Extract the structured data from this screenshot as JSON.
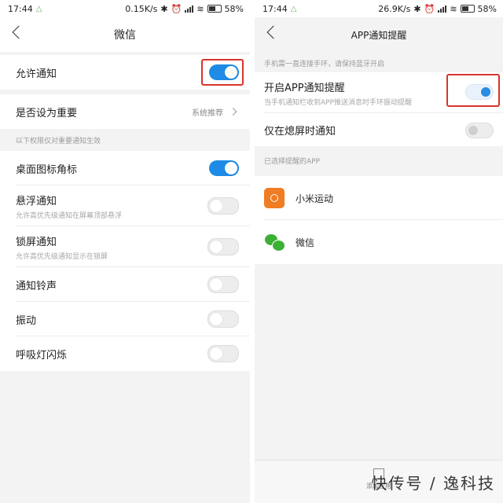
{
  "left": {
    "status": {
      "time": "17:44",
      "speed": "0.15K/s",
      "battery": "58%"
    },
    "title": "微信",
    "allow": {
      "label": "允许通知"
    },
    "important": {
      "label": "是否设为重要",
      "value": "系统推荐"
    },
    "section": "以下权限仅对重要通知生效",
    "items": [
      {
        "label": "桌面图标角标",
        "sub": "",
        "on": true
      },
      {
        "label": "悬浮通知",
        "sub": "允许高优先级通知在屏幕顶部悬浮",
        "on": false
      },
      {
        "label": "锁屏通知",
        "sub": "允许高优先级通知显示在锁屏",
        "on": false
      },
      {
        "label": "通知铃声",
        "sub": "",
        "on": false
      },
      {
        "label": "振动",
        "sub": "",
        "on": false
      },
      {
        "label": "呼吸灯闪烁",
        "sub": "",
        "on": false
      }
    ]
  },
  "right": {
    "status": {
      "time": "17:44",
      "speed": "26.9K/s",
      "battery": "58%"
    },
    "title": "APP通知提醒",
    "hint": "手机需一直连接手环，请保持蓝牙开启",
    "enable": {
      "label": "开启APP通知提醒",
      "sub": "当手机通知栏收到APP推送消息时手环振动提醒"
    },
    "screen_off": {
      "label": "仅在熄屏时通知"
    },
    "section": "已选择提醒的APP",
    "apps": [
      {
        "name": "小米运动",
        "icon": "mi-fit-icon"
      },
      {
        "name": "微信",
        "icon": "wechat-icon"
      }
    ],
    "add_label": "添加应用"
  },
  "colors": {
    "accent": "#1e8be6",
    "highlight": "#d9342a",
    "mi": "#f07c23",
    "wechat": "#3cb034"
  },
  "watermark": "快传号 / 逸科技"
}
